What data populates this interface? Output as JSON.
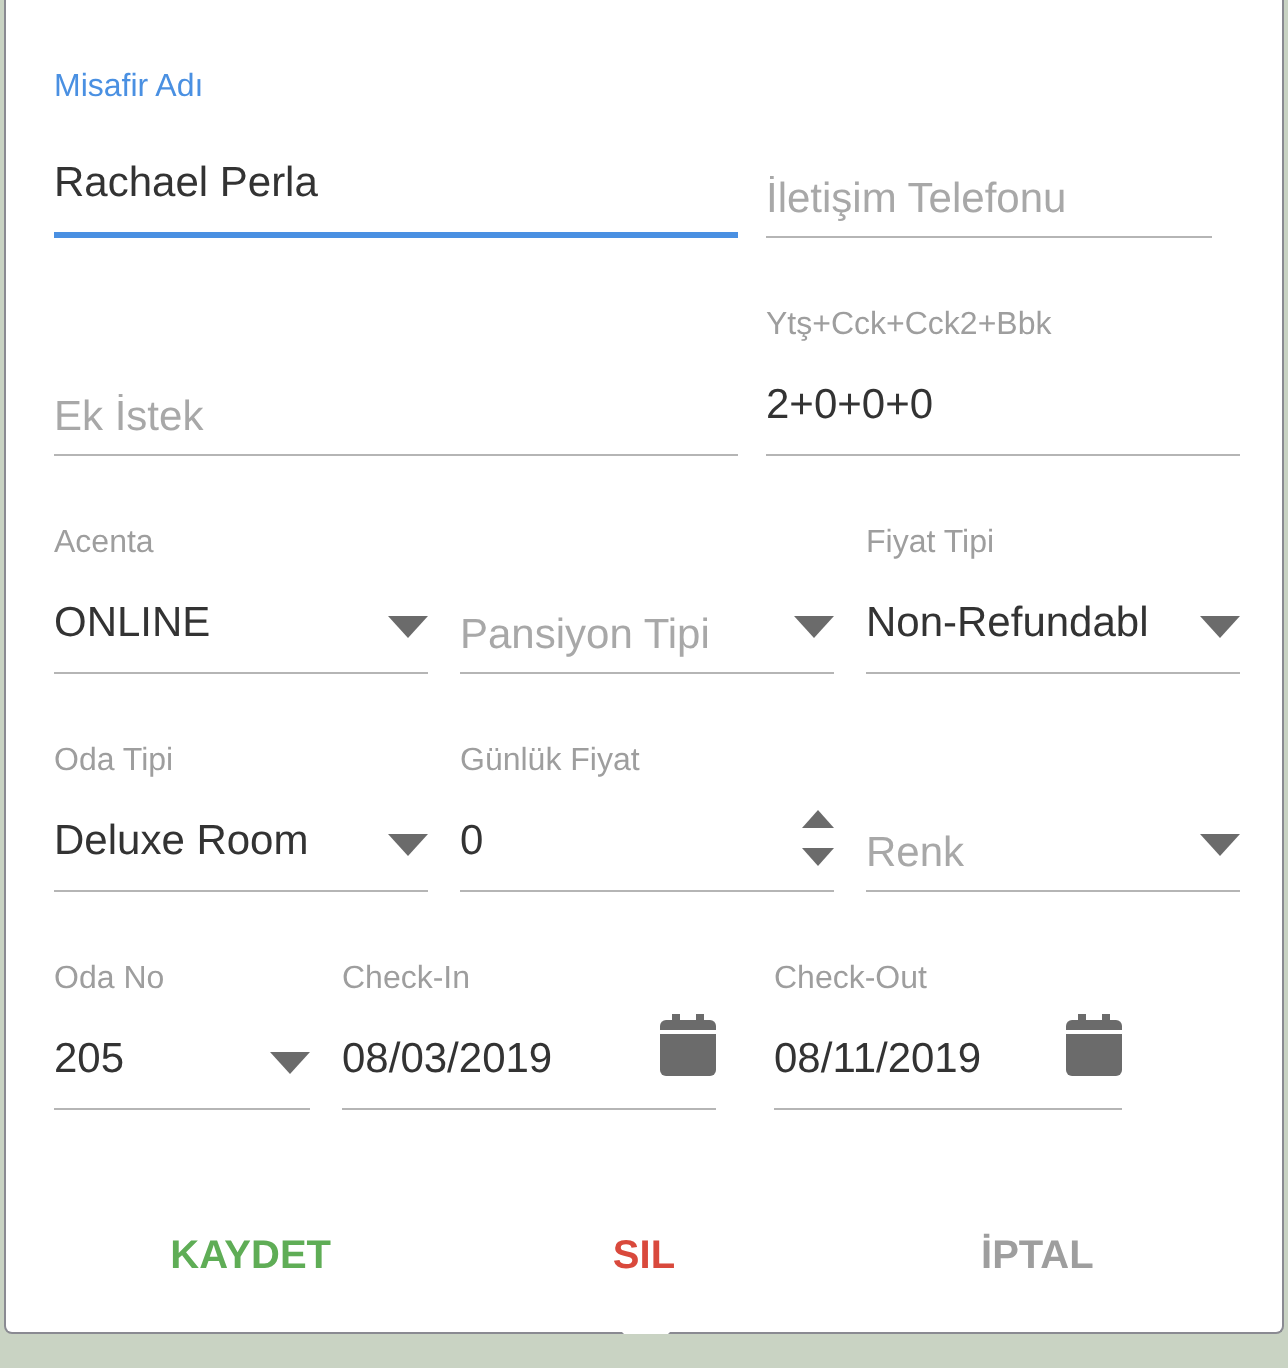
{
  "rows": [
    [
      {
        "kind": "text",
        "label": "Misafir Adı",
        "value": "Rachael Perla",
        "focused": true
      },
      {
        "kind": "text",
        "placeholder": "İletişim Telefonu",
        "focused": false
      }
    ],
    [
      {
        "kind": "text",
        "placeholder": "Ek İstek",
        "focused": false
      },
      {
        "kind": "text",
        "label": "Ytş+Cck+Cck2+Bbk",
        "value": "2+0+0+0",
        "focused": false
      }
    ],
    [
      {
        "kind": "select",
        "label": "Acenta",
        "value": "ONLINE",
        "focused": false
      },
      {
        "kind": "select",
        "placeholder": "Pansiyon Tipi",
        "focused": false
      },
      {
        "kind": "select",
        "label": "Fiyat Tipi",
        "value": "Non-Refundabl",
        "focused": false
      }
    ],
    [
      {
        "kind": "select",
        "label": "Oda Tipi",
        "value": "Deluxe Room",
        "focused": false
      },
      {
        "kind": "number",
        "label": "Günlük Fiyat",
        "value": "0",
        "focused": false
      },
      {
        "kind": "select",
        "placeholder": "Renk",
        "focused": false
      }
    ],
    [
      {
        "kind": "select",
        "label": "Oda No",
        "value": "205",
        "focused": false
      },
      {
        "kind": "date",
        "label": "Check-In",
        "value": "08/03/2019",
        "focused": false
      },
      {
        "kind": "date",
        "label": "Check-Out",
        "value": "08/11/2019",
        "focused": false
      }
    ]
  ],
  "buttons": [
    {
      "label": "KAYDET",
      "color": "#5fad56"
    },
    {
      "label": "SIL",
      "color": "#d9493c"
    },
    {
      "label": "İPTAL",
      "color": "#9e9e9e"
    }
  ]
}
